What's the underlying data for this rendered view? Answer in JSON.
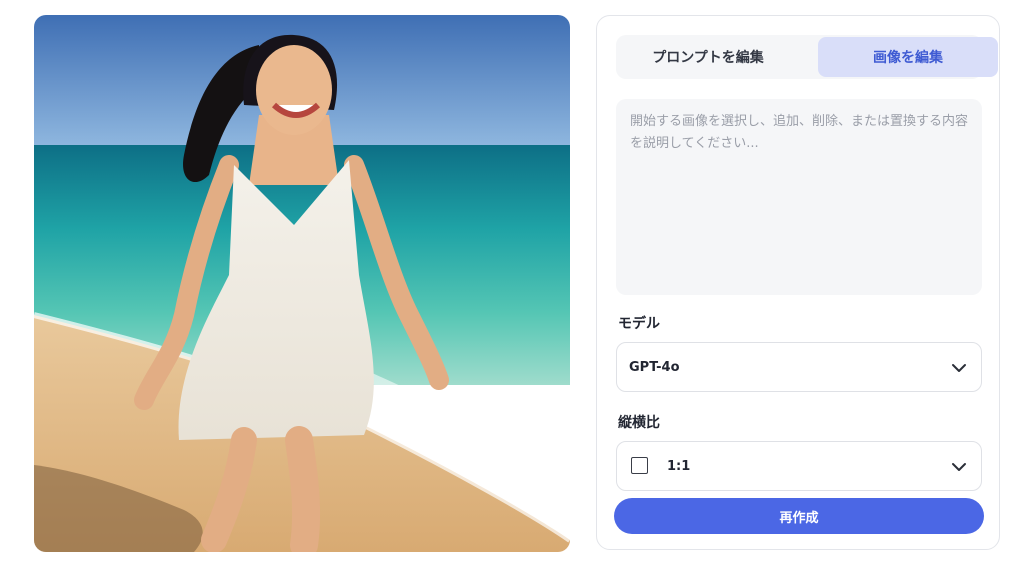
{
  "image": {
    "alt_icon": "beach-photo"
  },
  "panel": {
    "tabs": [
      {
        "label": "プロンプトを編集",
        "active": false
      },
      {
        "label": "画像を編集",
        "active": true
      }
    ],
    "prompt": {
      "value": "",
      "placeholder": "開始する画像を選択し、追加、削除、または置換する内容を説明してください..."
    },
    "model": {
      "label": "モデル",
      "selected": "GPT-4o",
      "icon": "chevron-down-icon"
    },
    "aspect": {
      "label": "縦横比",
      "selected": "1:1",
      "icon": "square-ratio-icon"
    },
    "regenerate_label": "再作成"
  },
  "colors": {
    "accent": "#4b67e5",
    "active_tab_bg": "#d9def9",
    "active_tab_text": "#3f5bd3",
    "field_bg": "#f5f6f8"
  }
}
